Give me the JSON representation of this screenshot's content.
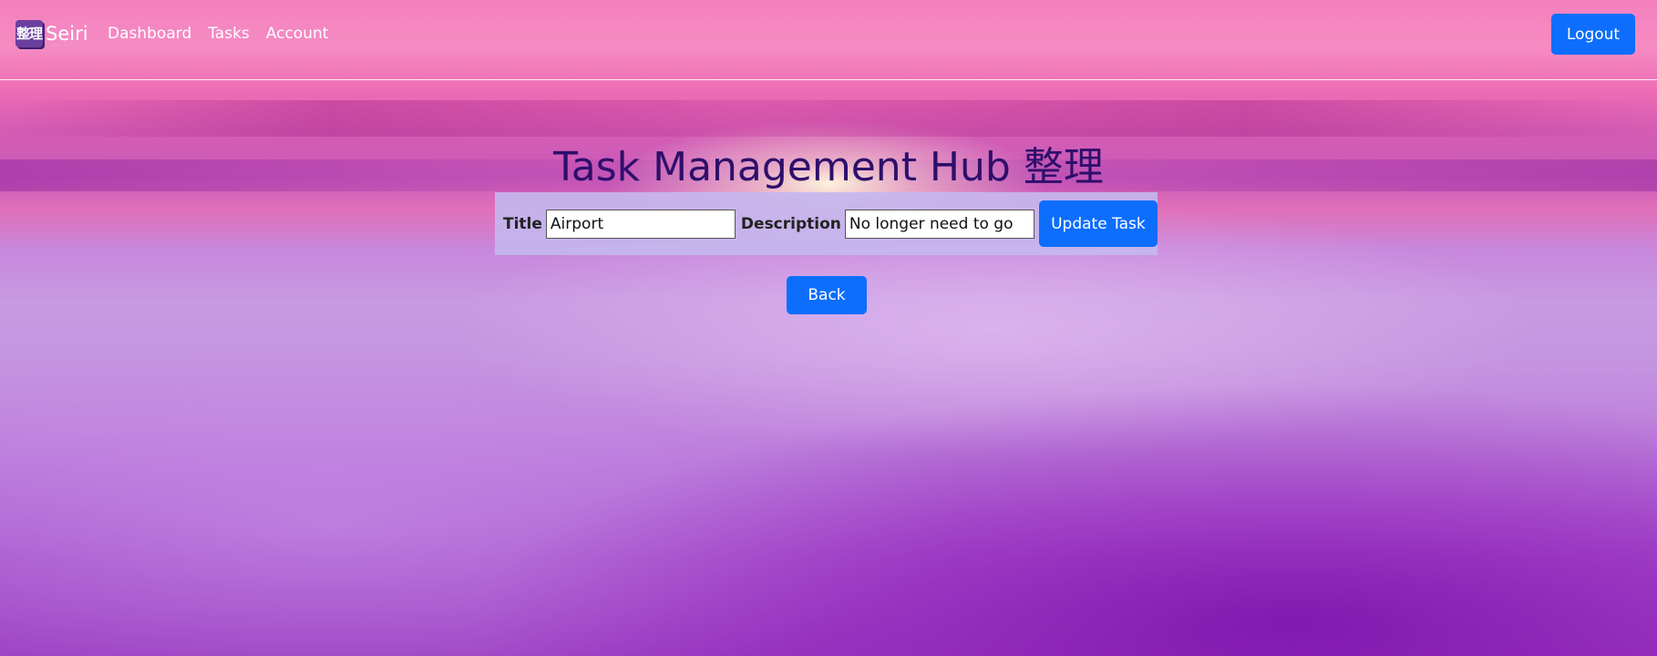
{
  "navbar": {
    "brand_logo": "整理",
    "brand_name": "Seiri",
    "links": [
      {
        "label": "Dashboard"
      },
      {
        "label": "Tasks"
      },
      {
        "label": "Account"
      }
    ],
    "logout_label": "Logout"
  },
  "main": {
    "title": "Task Management Hub 整理",
    "form": {
      "title_label": "Title",
      "title_value": "Airport",
      "description_label": "Description",
      "description_value": "No longer need to go",
      "submit_label": "Update Task"
    },
    "back_label": "Back"
  },
  "colors": {
    "primary_button": "#0d6efd",
    "title_text": "#2e0f6b",
    "form_background": "#c4b6ee"
  }
}
